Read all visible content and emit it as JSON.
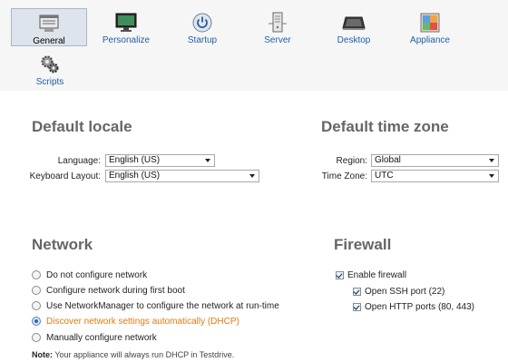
{
  "toolbar": {
    "items": [
      {
        "label": "General",
        "icon": "general-icon",
        "selected": true
      },
      {
        "label": "Personalize",
        "icon": "monitor-icon",
        "selected": false
      },
      {
        "label": "Startup",
        "icon": "power-icon",
        "selected": false
      },
      {
        "label": "Server",
        "icon": "server-icon",
        "selected": false
      },
      {
        "label": "Desktop",
        "icon": "desktop-icon",
        "selected": false
      },
      {
        "label": "Appliance",
        "icon": "appliance-icon",
        "selected": false
      },
      {
        "label": "Scripts",
        "icon": "gears-icon",
        "selected": false
      }
    ]
  },
  "locale": {
    "heading": "Default locale",
    "language_label": "Language:",
    "language_value": "English (US)",
    "keyboard_label": "Keyboard Layout:",
    "keyboard_value": "English (US)"
  },
  "timezone": {
    "heading": "Default time zone",
    "region_label": "Region:",
    "region_value": "Global",
    "zone_label": "Time Zone:",
    "zone_value": "UTC"
  },
  "network": {
    "heading": "Network",
    "options": [
      {
        "label": "Do not configure network",
        "selected": false
      },
      {
        "label": "Configure network during first boot",
        "selected": false
      },
      {
        "label": "Use NetworkManager to configure the network at run-time",
        "selected": false
      },
      {
        "label": "Discover network settings automatically (DHCP)",
        "selected": true
      },
      {
        "label": "Manually configure network",
        "selected": false
      }
    ],
    "note_prefix": "Note:",
    "note_text": " Your appliance will always run DHCP in Testdrive."
  },
  "firewall": {
    "heading": "Firewall",
    "enable_label": "Enable firewall",
    "ssh_label": "Open SSH port (22)",
    "http_label": "Open HTTP ports (80, 443)"
  },
  "colors": {
    "accent": "#1f5fa8",
    "active_option": "#e07a10",
    "heading": "#666666"
  }
}
